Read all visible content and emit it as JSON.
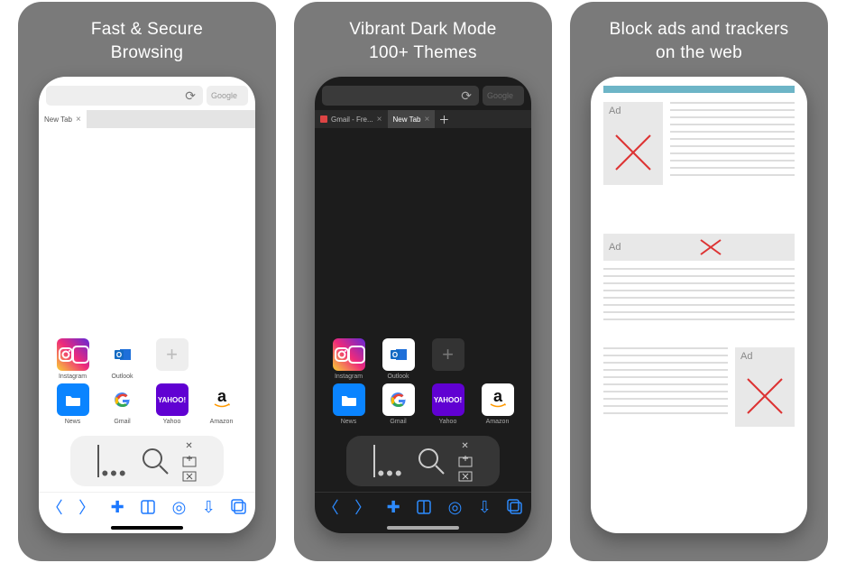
{
  "panels": [
    {
      "title": "Fast & Secure\nBrowsing"
    },
    {
      "title": "Vibrant Dark Mode\n100+ Themes"
    },
    {
      "title": "Block ads and trackers\non the web"
    }
  ],
  "search_placeholder": "Google",
  "tabs": {
    "light": [
      {
        "label": "New Tab",
        "active": true
      }
    ],
    "dark": [
      {
        "label": "Gmail - Fre...",
        "active": false
      },
      {
        "label": "New Tab",
        "active": true
      }
    ]
  },
  "shortcuts": [
    {
      "key": "instagram",
      "label": "Instagram"
    },
    {
      "key": "outlook",
      "label": "Outlook"
    },
    {
      "key": "add",
      "label": ""
    },
    {
      "key": "",
      "label": ""
    },
    {
      "key": "news",
      "label": "News"
    },
    {
      "key": "google",
      "label": "Gmail"
    },
    {
      "key": "yahoo",
      "label": "Yahoo"
    },
    {
      "key": "amazon",
      "label": "Amazon"
    }
  ],
  "ad_label": "Ad"
}
